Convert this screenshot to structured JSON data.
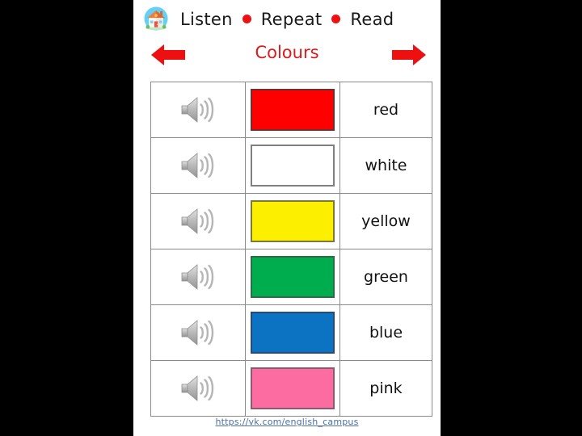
{
  "slide": {
    "background": "#000000",
    "canvas_background": "#ffffff"
  },
  "header": {
    "home_icon": "home-icon",
    "title_part1": "Listen",
    "title_part2": "Repeat",
    "title_part3": "Read",
    "dot_color": "#ee1111",
    "subtitle": "Colours",
    "subtitle_color": "#dd1a1a",
    "arrow_left": "arrow-left-icon",
    "arrow_right": "arrow-right-icon",
    "arrow_color": "#ee1010"
  },
  "table": {
    "rows": [
      {
        "audio_icon": "speaker-icon",
        "swatch_color": "#fe0000",
        "swatch_border": "#6b3030",
        "word": "red"
      },
      {
        "audio_icon": "speaker-icon",
        "swatch_color": "#ffffff",
        "swatch_border": "#808080",
        "word": "white"
      },
      {
        "audio_icon": "speaker-icon",
        "swatch_color": "#fdef00",
        "swatch_border": "#7a7a3a",
        "word": "yellow"
      },
      {
        "audio_icon": "speaker-icon",
        "swatch_color": "#00ad4e",
        "swatch_border": "#2f6b45",
        "word": "green"
      },
      {
        "audio_icon": "speaker-icon",
        "swatch_color": "#0c73c2",
        "swatch_border": "#2a4a70",
        "word": "blue"
      },
      {
        "audio_icon": "speaker-icon",
        "swatch_color": "#fc6ca0",
        "swatch_border": "#8a5a6e",
        "word": "pink"
      }
    ]
  },
  "footer": {
    "link_text": "https://vk.com/english_campus",
    "link_color": "#4a6fa8"
  }
}
